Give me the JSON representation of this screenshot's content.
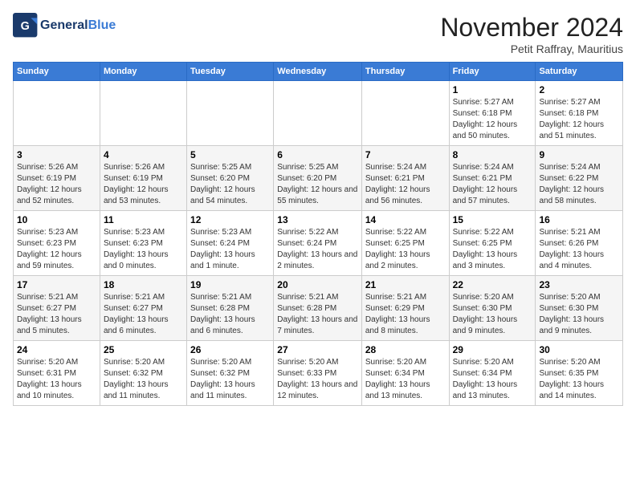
{
  "header": {
    "logo_line1": "General",
    "logo_line2": "Blue",
    "month": "November 2024",
    "location": "Petit Raffray, Mauritius"
  },
  "weekdays": [
    "Sunday",
    "Monday",
    "Tuesday",
    "Wednesday",
    "Thursday",
    "Friday",
    "Saturday"
  ],
  "weeks": [
    [
      {
        "day": "",
        "info": ""
      },
      {
        "day": "",
        "info": ""
      },
      {
        "day": "",
        "info": ""
      },
      {
        "day": "",
        "info": ""
      },
      {
        "day": "",
        "info": ""
      },
      {
        "day": "1",
        "info": "Sunrise: 5:27 AM\nSunset: 6:18 PM\nDaylight: 12 hours and 50 minutes."
      },
      {
        "day": "2",
        "info": "Sunrise: 5:27 AM\nSunset: 6:18 PM\nDaylight: 12 hours and 51 minutes."
      }
    ],
    [
      {
        "day": "3",
        "info": "Sunrise: 5:26 AM\nSunset: 6:19 PM\nDaylight: 12 hours and 52 minutes."
      },
      {
        "day": "4",
        "info": "Sunrise: 5:26 AM\nSunset: 6:19 PM\nDaylight: 12 hours and 53 minutes."
      },
      {
        "day": "5",
        "info": "Sunrise: 5:25 AM\nSunset: 6:20 PM\nDaylight: 12 hours and 54 minutes."
      },
      {
        "day": "6",
        "info": "Sunrise: 5:25 AM\nSunset: 6:20 PM\nDaylight: 12 hours and 55 minutes."
      },
      {
        "day": "7",
        "info": "Sunrise: 5:24 AM\nSunset: 6:21 PM\nDaylight: 12 hours and 56 minutes."
      },
      {
        "day": "8",
        "info": "Sunrise: 5:24 AM\nSunset: 6:21 PM\nDaylight: 12 hours and 57 minutes."
      },
      {
        "day": "9",
        "info": "Sunrise: 5:24 AM\nSunset: 6:22 PM\nDaylight: 12 hours and 58 minutes."
      }
    ],
    [
      {
        "day": "10",
        "info": "Sunrise: 5:23 AM\nSunset: 6:23 PM\nDaylight: 12 hours and 59 minutes."
      },
      {
        "day": "11",
        "info": "Sunrise: 5:23 AM\nSunset: 6:23 PM\nDaylight: 13 hours and 0 minutes."
      },
      {
        "day": "12",
        "info": "Sunrise: 5:23 AM\nSunset: 6:24 PM\nDaylight: 13 hours and 1 minute."
      },
      {
        "day": "13",
        "info": "Sunrise: 5:22 AM\nSunset: 6:24 PM\nDaylight: 13 hours and 2 minutes."
      },
      {
        "day": "14",
        "info": "Sunrise: 5:22 AM\nSunset: 6:25 PM\nDaylight: 13 hours and 2 minutes."
      },
      {
        "day": "15",
        "info": "Sunrise: 5:22 AM\nSunset: 6:25 PM\nDaylight: 13 hours and 3 minutes."
      },
      {
        "day": "16",
        "info": "Sunrise: 5:21 AM\nSunset: 6:26 PM\nDaylight: 13 hours and 4 minutes."
      }
    ],
    [
      {
        "day": "17",
        "info": "Sunrise: 5:21 AM\nSunset: 6:27 PM\nDaylight: 13 hours and 5 minutes."
      },
      {
        "day": "18",
        "info": "Sunrise: 5:21 AM\nSunset: 6:27 PM\nDaylight: 13 hours and 6 minutes."
      },
      {
        "day": "19",
        "info": "Sunrise: 5:21 AM\nSunset: 6:28 PM\nDaylight: 13 hours and 6 minutes."
      },
      {
        "day": "20",
        "info": "Sunrise: 5:21 AM\nSunset: 6:28 PM\nDaylight: 13 hours and 7 minutes."
      },
      {
        "day": "21",
        "info": "Sunrise: 5:21 AM\nSunset: 6:29 PM\nDaylight: 13 hours and 8 minutes."
      },
      {
        "day": "22",
        "info": "Sunrise: 5:20 AM\nSunset: 6:30 PM\nDaylight: 13 hours and 9 minutes."
      },
      {
        "day": "23",
        "info": "Sunrise: 5:20 AM\nSunset: 6:30 PM\nDaylight: 13 hours and 9 minutes."
      }
    ],
    [
      {
        "day": "24",
        "info": "Sunrise: 5:20 AM\nSunset: 6:31 PM\nDaylight: 13 hours and 10 minutes."
      },
      {
        "day": "25",
        "info": "Sunrise: 5:20 AM\nSunset: 6:32 PM\nDaylight: 13 hours and 11 minutes."
      },
      {
        "day": "26",
        "info": "Sunrise: 5:20 AM\nSunset: 6:32 PM\nDaylight: 13 hours and 11 minutes."
      },
      {
        "day": "27",
        "info": "Sunrise: 5:20 AM\nSunset: 6:33 PM\nDaylight: 13 hours and 12 minutes."
      },
      {
        "day": "28",
        "info": "Sunrise: 5:20 AM\nSunset: 6:34 PM\nDaylight: 13 hours and 13 minutes."
      },
      {
        "day": "29",
        "info": "Sunrise: 5:20 AM\nSunset: 6:34 PM\nDaylight: 13 hours and 13 minutes."
      },
      {
        "day": "30",
        "info": "Sunrise: 5:20 AM\nSunset: 6:35 PM\nDaylight: 13 hours and 14 minutes."
      }
    ]
  ]
}
